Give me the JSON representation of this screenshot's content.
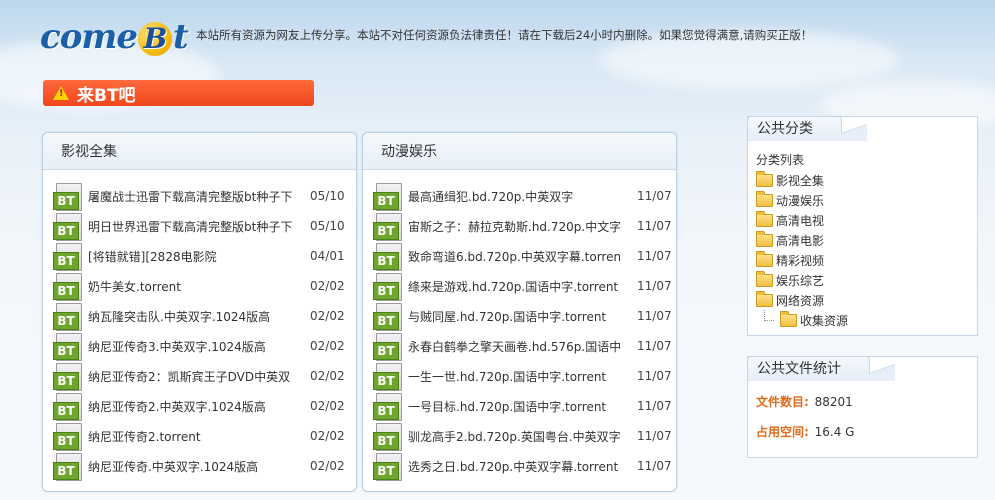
{
  "header": {
    "logo_text": "comeBt",
    "notice": "本站所有资源为网友上传分享。本站不对任何资源负法律责任！请在下载后24小时内删除。如果您觉得满意,请购买正版！"
  },
  "banner": {
    "title": "来BT吧"
  },
  "icon_label": "BT",
  "movies": {
    "title": "影视全集",
    "items": [
      {
        "title": "屠魔战士迅雷下载高清完整版bt种子下",
        "date": "05/10"
      },
      {
        "title": "明日世界迅雷下载高清完整版bt种子下",
        "date": "05/10"
      },
      {
        "title": "[将错就错][2828电影院",
        "date": "04/01"
      },
      {
        "title": "奶牛美女.torrent",
        "date": "02/02"
      },
      {
        "title": "纳瓦隆突击队.中英双字.1024版高",
        "date": "02/02"
      },
      {
        "title": "纳尼亚传奇3.中英双字.1024版高",
        "date": "02/02"
      },
      {
        "title": "纳尼亚传奇2：凯斯宾王子DVD中英双",
        "date": "02/02"
      },
      {
        "title": "纳尼亚传奇2.中英双字.1024版高",
        "date": "02/02"
      },
      {
        "title": "纳尼亚传奇2.torrent",
        "date": "02/02"
      },
      {
        "title": "纳尼亚传奇.中英双字.1024版高",
        "date": "02/02"
      }
    ]
  },
  "anime": {
    "title": "动漫娱乐",
    "items": [
      {
        "title": "最高通缉犯.bd.720p.中英双字",
        "date": "11/07"
      },
      {
        "title": "宙斯之子：赫拉克勒斯.hd.720p.中文字",
        "date": "11/07"
      },
      {
        "title": "致命弯道6.bd.720p.中英双字幕.torrent",
        "date": "11/07"
      },
      {
        "title": "绦来是游戏.hd.720p.国语中字.torrent",
        "date": "11/07"
      },
      {
        "title": "与贼同屋.hd.720p.国语中字.torrent",
        "date": "11/07"
      },
      {
        "title": "永春白鹤拳之擎天画卷.hd.576p.国语中",
        "date": "11/07"
      },
      {
        "title": "一生一世.hd.720p.国语中字.torrent",
        "date": "11/07"
      },
      {
        "title": "一号目标.hd.720p.国语中字.torrent",
        "date": "11/07"
      },
      {
        "title": "驯龙高手2.bd.720p.英国粤台.中英双字",
        "date": "11/07"
      },
      {
        "title": "选秀之日.bd.720p.中英双字幕.torrent",
        "date": "11/07"
      }
    ]
  },
  "sidebar": {
    "categories": {
      "title": "公共分类",
      "root_label": "分类列表",
      "items": [
        "影视全集",
        "动漫娱乐",
        "高清电视",
        "高清电影",
        "精彩视频",
        "娱乐综艺",
        "网络资源"
      ],
      "sub_item": "收集资源"
    },
    "stats": {
      "title": "公共文件统计",
      "file_count_label": "文件数目:",
      "file_count": "88201",
      "space_label": "占用空间:",
      "space": "16.4 G"
    }
  }
}
